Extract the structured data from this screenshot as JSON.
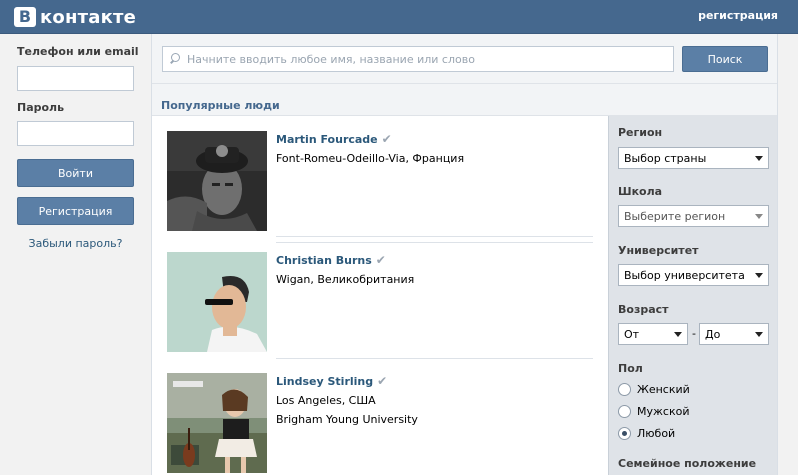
{
  "header": {
    "logo_letter": "В",
    "logo_text": "контакте",
    "register_link": "регистрация"
  },
  "login": {
    "phone_label": "Телефон или email",
    "password_label": "Пароль",
    "login_button": "Войти",
    "register_button": "Регистрация",
    "forgot_link": "Забыли пароль?"
  },
  "search": {
    "placeholder": "Начните вводить любое имя, название или слово",
    "button": "Поиск"
  },
  "section_title": "Популярные люди",
  "people": [
    {
      "name": "Martin Fourcade",
      "lines": [
        "Font-Romeu-Odeillo-Via, Франция"
      ]
    },
    {
      "name": "Christian Burns",
      "lines": [
        "Wigan, Великобритания"
      ]
    },
    {
      "name": "Lindsey Stirling",
      "lines": [
        "Los Angeles, США",
        "Brigham Young University"
      ]
    }
  ],
  "filters": {
    "region_label": "Регион",
    "region_value": "Выбор страны",
    "school_label": "Школа",
    "school_value": "Выберите регион",
    "university_label": "Университет",
    "university_value": "Выбор университета",
    "age_label": "Возраст",
    "age_from": "От",
    "age_sep": "-",
    "age_to": "До",
    "gender_label": "Пол",
    "gender_options": [
      "Женский",
      "Мужской",
      "Любой"
    ],
    "gender_selected": "Любой",
    "marital_label": "Семейное положение"
  },
  "colors": {
    "header": "#45688e",
    "button": "#5b7fa6",
    "link": "#2b587a"
  }
}
